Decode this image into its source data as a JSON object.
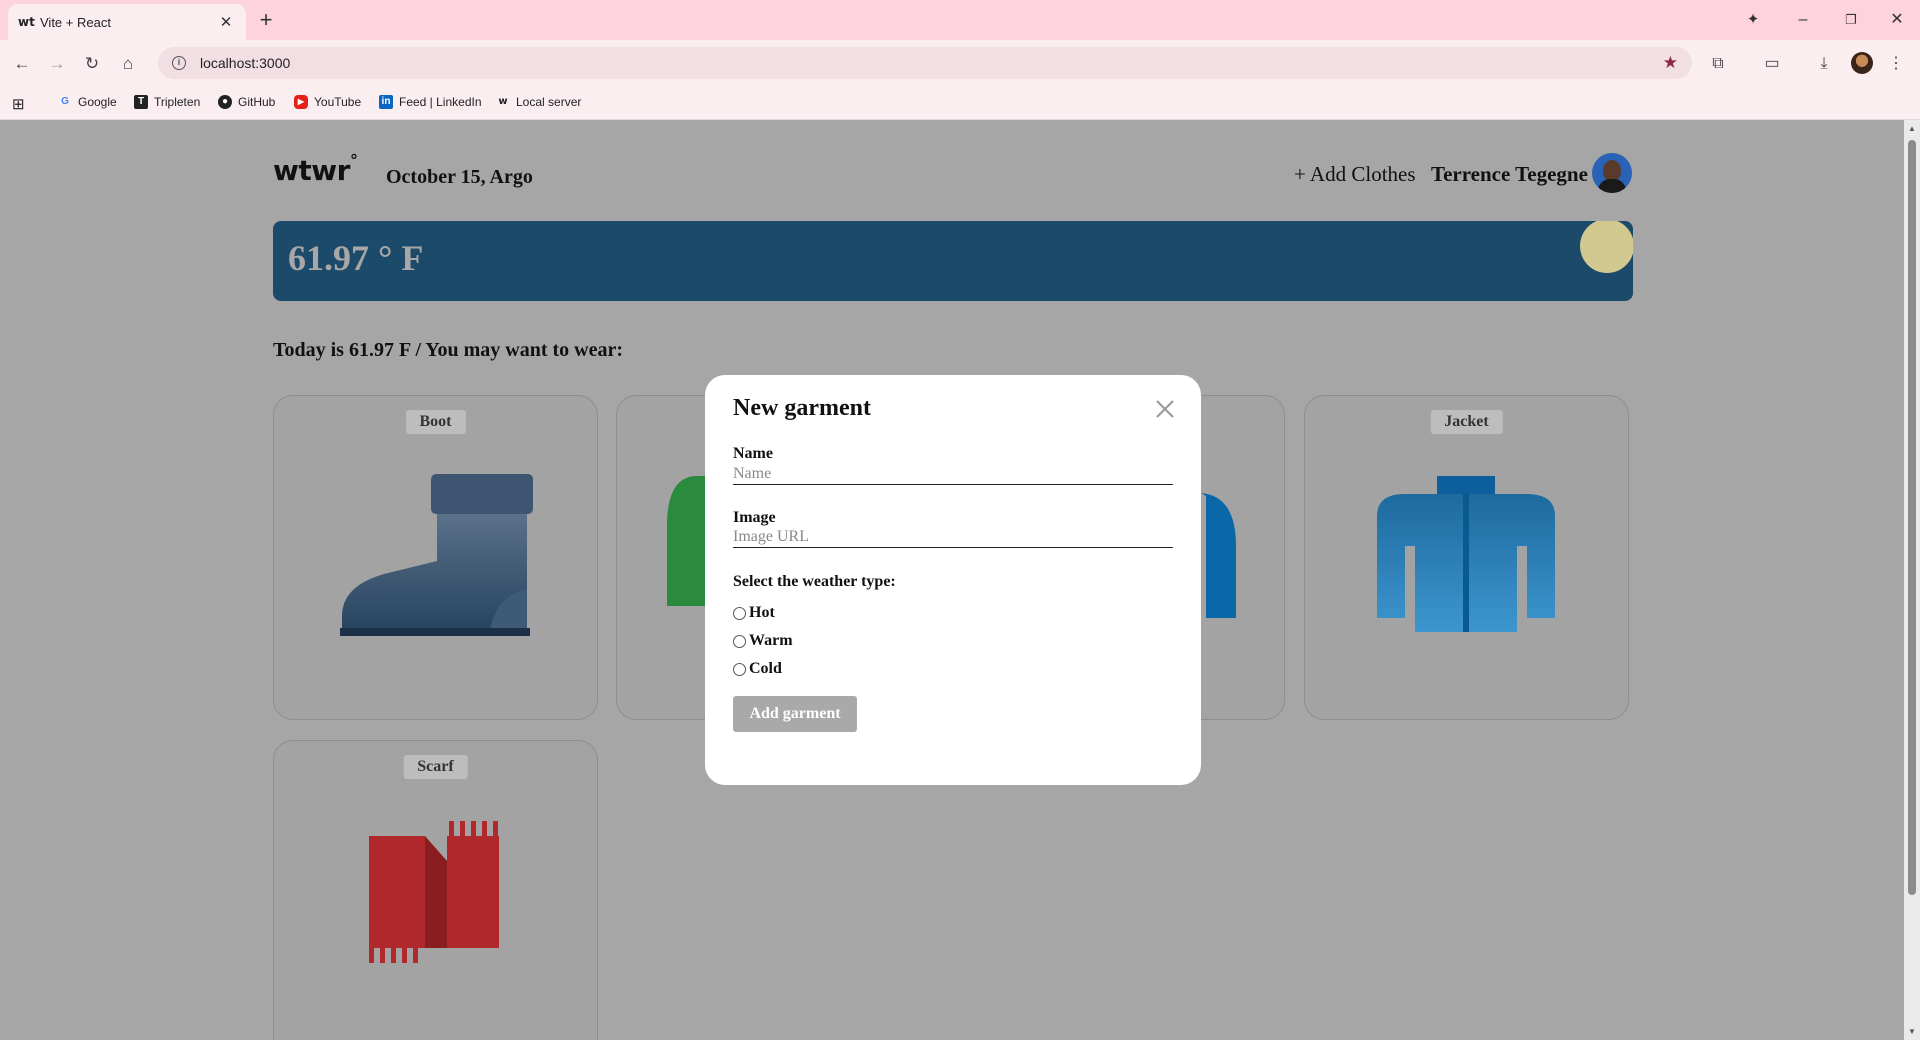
{
  "browser": {
    "tab_title": "Vite + React",
    "tab_favicon": "wt",
    "new_tab_symbol": "+",
    "url": "localhost:3000",
    "bookmarks": [
      {
        "label": "Google",
        "icon": "google-icon"
      },
      {
        "label": "Tripleten",
        "icon": "tripleten-icon"
      },
      {
        "label": "GitHub",
        "icon": "github-icon"
      },
      {
        "label": "YouTube",
        "icon": "youtube-icon"
      },
      {
        "label": "Feed | LinkedIn",
        "icon": "linkedin-icon"
      },
      {
        "label": "Local server",
        "icon": "wt-icon"
      }
    ]
  },
  "header": {
    "logo": "wtwr",
    "logo_mark": "°",
    "date_location": "October 15, Argo",
    "add_clothes": "+ Add Clothes",
    "username": "Terrence Tegegne"
  },
  "weather": {
    "temperature": "61.97 ° F",
    "accent_color": "#1c4a6a",
    "sun_color": "#d2c991"
  },
  "main": {
    "today_text": "Today is 61.97 F / You may want to wear:",
    "cards": [
      {
        "label": "Boot",
        "icon": "boot-icon"
      },
      {
        "label": "",
        "icon": "cap-icon"
      },
      {
        "label": "",
        "icon": "coat-icon"
      },
      {
        "label": "Jacket",
        "icon": "jacket-icon"
      },
      {
        "label": "Scarf",
        "icon": "scarf-icon"
      }
    ]
  },
  "modal": {
    "title": "New garment",
    "name_label": "Name",
    "name_placeholder": "Name",
    "name_value": "",
    "image_label": "Image",
    "image_placeholder": "Image URL",
    "image_value": "",
    "weather_legend": "Select the weather type:",
    "options": [
      "Hot",
      "Warm",
      "Cold"
    ],
    "selected_option": null,
    "submit_label": "Add garment"
  }
}
